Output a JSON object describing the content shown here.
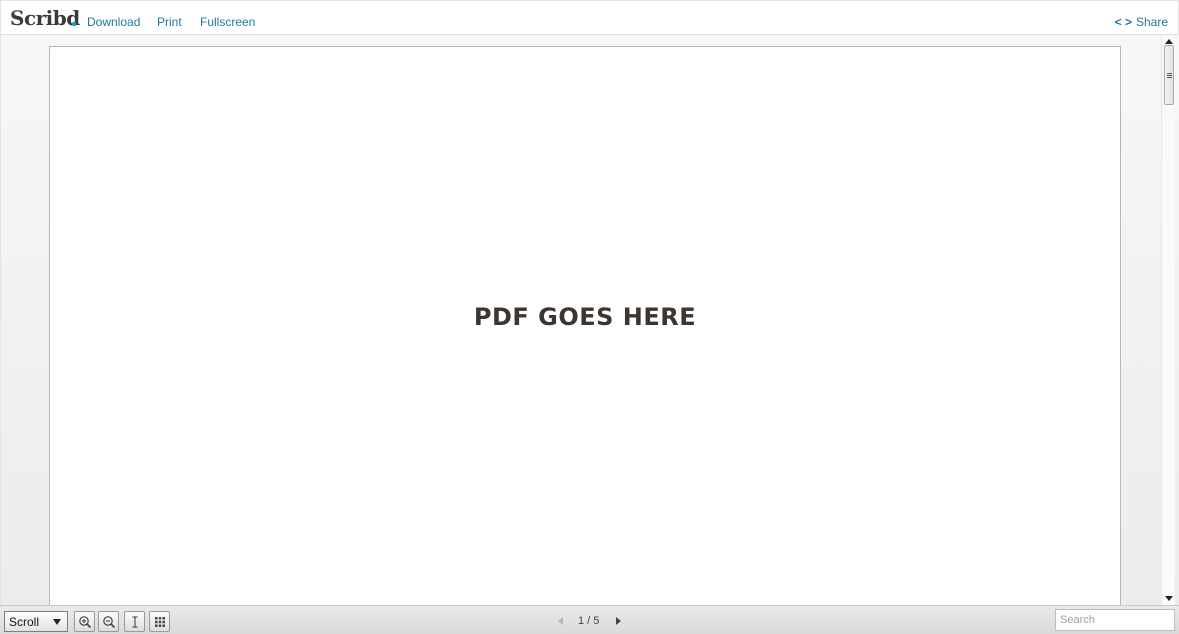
{
  "header": {
    "logo": "Scribd",
    "links": {
      "download": "Download",
      "print": "Print",
      "fullscreen": "Fullscreen"
    },
    "share": {
      "code": "< >",
      "label": "Share"
    }
  },
  "document": {
    "placeholder_text": "PDF GOES HERE"
  },
  "footer": {
    "view_mode": "Scroll",
    "page_indicator": "1 / 5",
    "search_placeholder": "Search"
  },
  "colors": {
    "link": "#1f78a4",
    "logo_dot": "#1a9cc6",
    "page_text": "#3e3430"
  },
  "icons": [
    "zoom-in-icon",
    "zoom-out-icon",
    "text-select-icon",
    "grid-view-icon",
    "prev-page-icon",
    "next-page-icon"
  ]
}
